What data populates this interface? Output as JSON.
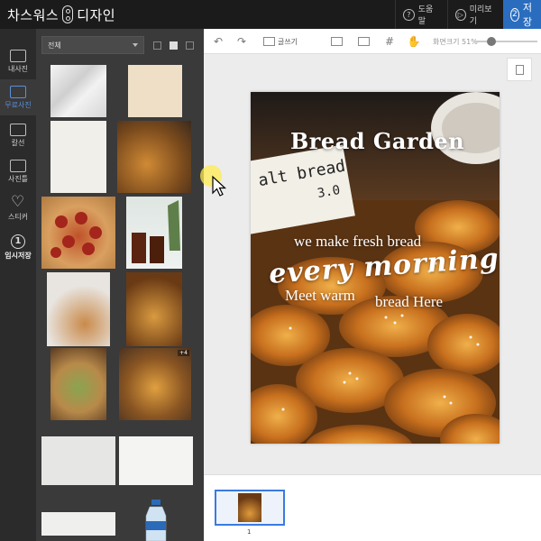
{
  "app": {
    "title": "차스워스",
    "title_suffix": "디자인"
  },
  "topbar": {
    "help_label": "도움말",
    "preview_label": "미리보기",
    "save_label": "저장",
    "save_num": "2",
    "help_icon": "?",
    "accent": "#2a6dbf"
  },
  "leftnav": [
    {
      "label": "내사진",
      "icon": "camera-icon"
    },
    {
      "label": "무료사진",
      "icon": "free-photo-icon",
      "active": true
    },
    {
      "label": "칼선",
      "icon": "scissors-icon"
    },
    {
      "label": "사진틀",
      "icon": "frame-icon"
    },
    {
      "label": "스티커",
      "icon": "heart-icon"
    },
    {
      "label": "임시저장",
      "icon": "temp-save-icon",
      "glyph": "1"
    }
  ],
  "panel": {
    "filter_value": "전체",
    "badge_count": "+4"
  },
  "toolbar": {
    "write_label": "글쓰기",
    "zoom_label": "화면크기 51%"
  },
  "design": {
    "title": "Bread Garden",
    "subtitle": "we make fresh bread",
    "script_line": "every morning",
    "line_meet": "Meet warm",
    "line_here": "bread Here",
    "sign_text": "alt bread",
    "sign_price": "3.0"
  },
  "pages": {
    "current": "1"
  }
}
